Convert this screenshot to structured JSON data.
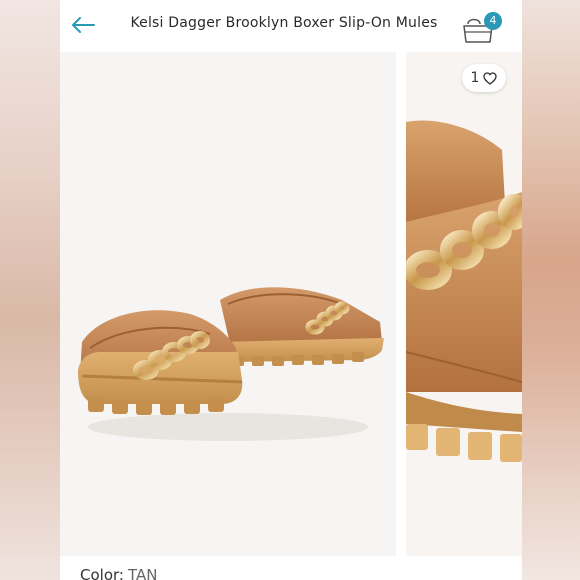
{
  "header": {
    "title": "Kelsi Dagger Brooklyn Boxer Slip-On Mules",
    "back_icon": "arrow-left-icon",
    "bag_icon": "shopping-bag-icon",
    "bag_count": "4",
    "accent_color": "#2a99b5"
  },
  "gallery": {
    "like_count": "1",
    "like_icon": "heart-icon"
  },
  "details": {
    "color_label": "Color:",
    "color_value": "TAN"
  }
}
